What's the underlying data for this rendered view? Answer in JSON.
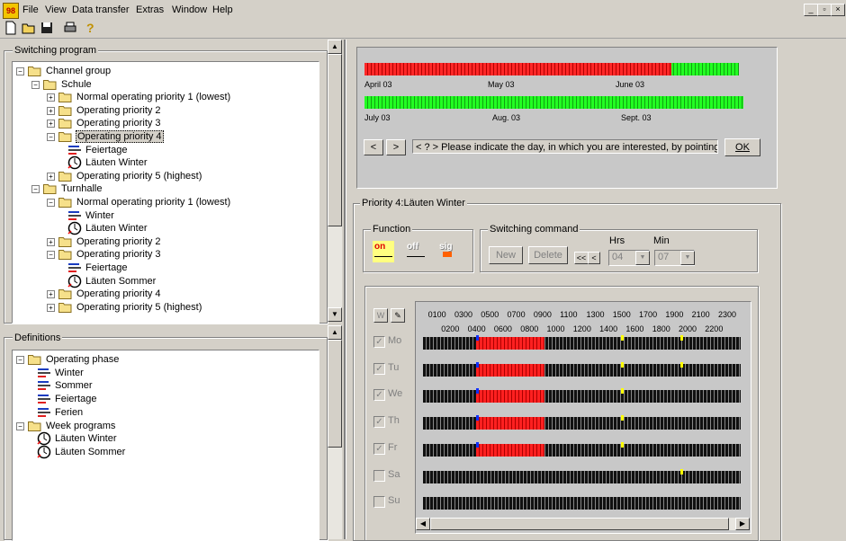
{
  "menu": {
    "items": [
      "File",
      "View",
      "Data transfer",
      "Extras",
      "Window",
      "Help"
    ]
  },
  "window_controls": [
    "_",
    "▫",
    "×"
  ],
  "switching_program": {
    "title": "Switching program",
    "tree": [
      {
        "label": "Channel group",
        "level": 0,
        "type": "folder",
        "exp": "-"
      },
      {
        "label": "Schule",
        "level": 1,
        "type": "folder",
        "exp": "-"
      },
      {
        "label": "Normal operating priority 1 (lowest)",
        "level": 2,
        "type": "folder",
        "exp": "+"
      },
      {
        "label": "Operating priority 2",
        "level": 2,
        "type": "folder",
        "exp": "+"
      },
      {
        "label": "Operating priority 3",
        "level": 2,
        "type": "folder",
        "exp": "+"
      },
      {
        "label": "Operating priority 4",
        "level": 2,
        "type": "folder",
        "exp": "-",
        "selected": true
      },
      {
        "label": "Feiertage",
        "level": 3,
        "type": "phase"
      },
      {
        "label": "Läuten Winter",
        "level": 3,
        "type": "week"
      },
      {
        "label": "Operating priority 5 (highest)",
        "level": 2,
        "type": "folder",
        "exp": "+"
      },
      {
        "label": "Turnhalle",
        "level": 1,
        "type": "folder",
        "exp": "-"
      },
      {
        "label": "Normal operating priority 1 (lowest)",
        "level": 2,
        "type": "folder",
        "exp": "-"
      },
      {
        "label": "Winter",
        "level": 3,
        "type": "phase"
      },
      {
        "label": "Läuten Winter",
        "level": 3,
        "type": "week"
      },
      {
        "label": "Operating priority 2",
        "level": 2,
        "type": "folder",
        "exp": "+"
      },
      {
        "label": "Operating priority 3",
        "level": 2,
        "type": "folder",
        "exp": "-"
      },
      {
        "label": "Feiertage",
        "level": 3,
        "type": "phase"
      },
      {
        "label": "Läuten Sommer",
        "level": 3,
        "type": "week"
      },
      {
        "label": "Operating priority 4",
        "level": 2,
        "type": "folder",
        "exp": "+"
      },
      {
        "label": "Operating priority 5 (highest)",
        "level": 2,
        "type": "folder",
        "exp": "+"
      }
    ]
  },
  "definitions": {
    "title": "Definitions",
    "tree": [
      {
        "label": "Operating phase",
        "level": 0,
        "type": "folder",
        "exp": "-"
      },
      {
        "label": "Winter",
        "level": 1,
        "type": "phase"
      },
      {
        "label": "Sommer",
        "level": 1,
        "type": "phase"
      },
      {
        "label": "Feiertage",
        "level": 1,
        "type": "phase"
      },
      {
        "label": "Ferien",
        "level": 1,
        "type": "phase"
      },
      {
        "label": "Week programs",
        "level": 0,
        "type": "folder",
        "exp": "-"
      },
      {
        "label": "Läuten Winter",
        "level": 1,
        "type": "week"
      },
      {
        "label": "Läuten Sommer",
        "level": 1,
        "type": "week"
      }
    ]
  },
  "calendar": {
    "row1": {
      "months": [
        "April 03",
        "May 03",
        "June 03"
      ],
      "red_fraction": 0.82
    },
    "row2": {
      "months": [
        "July 03",
        "Aug. 03",
        "Sept. 03"
      ],
      "red_fraction": 0
    },
    "prev_label": "<",
    "next_label": ">",
    "prompt": "< ? > Please indicate the day, in which you are interested, by pointing with the",
    "ok_label": "OK"
  },
  "priority_panel": {
    "title": "Priority 4:Läuten Winter",
    "function_label": "Function",
    "functions": [
      {
        "label": "on",
        "active": true
      },
      {
        "label": "off",
        "active": false
      },
      {
        "label": "sig",
        "active": false
      }
    ],
    "switching_command_label": "Switching command",
    "new_label": "New",
    "delete_label": "Delete",
    "nav_prev": "<<",
    "nav_step_back": "<",
    "nav_step_fwd": ">",
    "hrs_label": "Hrs",
    "min_label": "Min",
    "hrs_value": "04",
    "min_value": "07"
  },
  "schedule": {
    "hours_top": [
      "0100",
      "0300",
      "0500",
      "0700",
      "0900",
      "1100",
      "1300",
      "1500",
      "1700",
      "1900",
      "2100",
      "2300"
    ],
    "hours_bottom": [
      "0200",
      "0400",
      "0600",
      "0800",
      "1000",
      "1200",
      "1400",
      "1600",
      "1800",
      "2000",
      "2200"
    ],
    "days": [
      {
        "label": "Mo",
        "checked": true,
        "red_from": 4.0,
        "red_to": 9.2,
        "blue": 4.0,
        "yellow": [
          15.0,
          19.5
        ]
      },
      {
        "label": "Tu",
        "checked": true,
        "red_from": 4.0,
        "red_to": 9.2,
        "blue": 4.0,
        "yellow": [
          15.0,
          19.5
        ]
      },
      {
        "label": "We",
        "checked": true,
        "red_from": 4.0,
        "red_to": 9.2,
        "blue": 4.0,
        "yellow": [
          15.0
        ]
      },
      {
        "label": "Th",
        "checked": true,
        "red_from": 4.0,
        "red_to": 9.2,
        "blue": 4.0,
        "yellow": [
          15.0
        ]
      },
      {
        "label": "Fr",
        "checked": true,
        "red_from": 4.0,
        "red_to": 9.2,
        "blue": 4.0,
        "yellow": [
          15.0
        ]
      },
      {
        "label": "Sa",
        "checked": false,
        "yellow": [
          19.5
        ]
      },
      {
        "label": "Su",
        "checked": false,
        "yellow": []
      }
    ]
  }
}
